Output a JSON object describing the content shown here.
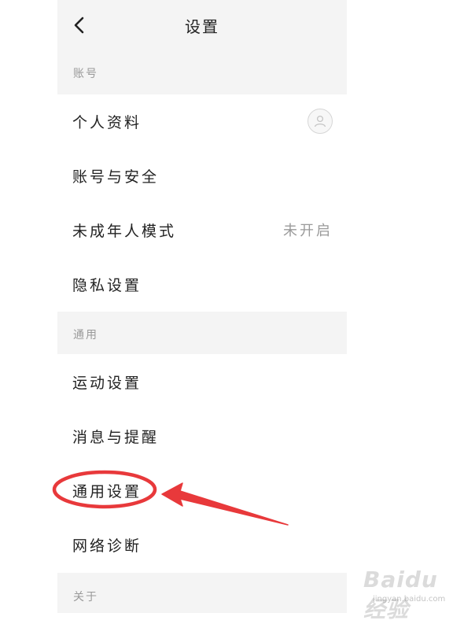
{
  "header": {
    "title": "设置",
    "back_icon": "chevron-left-icon"
  },
  "sections": {
    "account": {
      "header": "账号",
      "items": [
        {
          "label": "个人资料",
          "trailing_icon": "avatar-icon"
        },
        {
          "label": "账号与安全"
        },
        {
          "label": "未成年人模式",
          "value": "未开启"
        },
        {
          "label": "隐私设置"
        }
      ]
    },
    "general": {
      "header": "通用",
      "items": [
        {
          "label": "运动设置"
        },
        {
          "label": "消息与提醒"
        },
        {
          "label": "通用设置"
        },
        {
          "label": "网络诊断"
        }
      ]
    },
    "about": {
      "header": "关于"
    }
  },
  "annotation": {
    "color": "#e8393b",
    "highlight_target": "通用设置"
  },
  "watermark": {
    "text": "Baidu经验",
    "sub": "jingyan.baidu.com"
  }
}
